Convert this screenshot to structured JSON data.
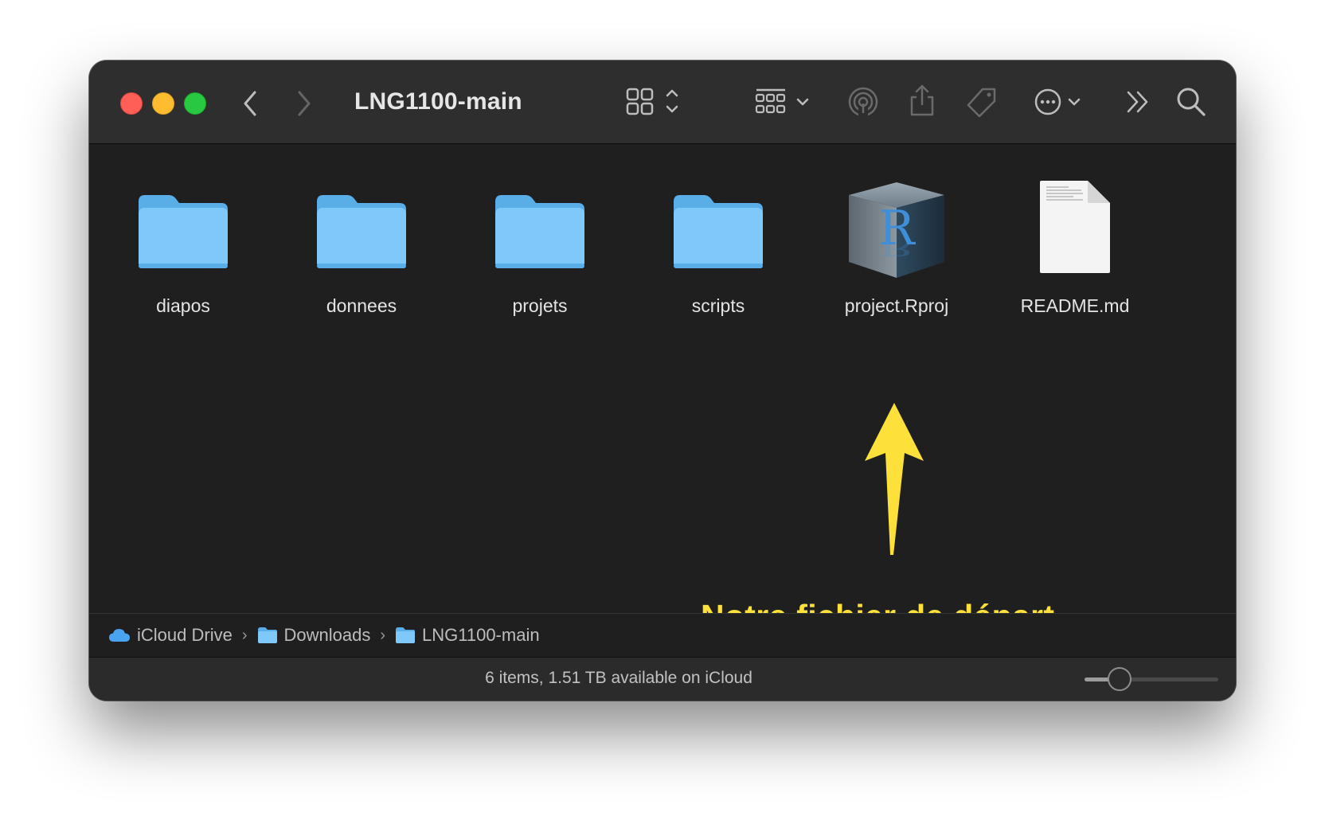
{
  "window": {
    "title": "LNG1100-main"
  },
  "toolbar": {
    "icons": [
      "back-icon",
      "forward-icon",
      "grid-view-icon",
      "group-icon",
      "airdrop-icon",
      "share-icon",
      "tag-icon",
      "more-icon",
      "overflow-icon",
      "search-icon"
    ]
  },
  "items": [
    {
      "name": "diapos",
      "kind": "folder"
    },
    {
      "name": "donnees",
      "kind": "folder"
    },
    {
      "name": "projets",
      "kind": "folder"
    },
    {
      "name": "scripts",
      "kind": "folder"
    },
    {
      "name": "project.Rproj",
      "kind": "rproj"
    },
    {
      "name": "README.md",
      "kind": "document"
    }
  ],
  "annotation": {
    "text": "Notre fichier de départ",
    "color": "#fde13a"
  },
  "pathbar": {
    "crumbs": [
      "iCloud Drive",
      "Downloads",
      "LNG1100-main"
    ],
    "separator": "›"
  },
  "statusbar": {
    "text": "6 items, 1.51 TB available on iCloud",
    "icon_size_fraction": 0.26
  },
  "colors": {
    "folder": "#78c8f8",
    "accent_yellow": "#fde13a",
    "background": "#1f1f1f"
  }
}
